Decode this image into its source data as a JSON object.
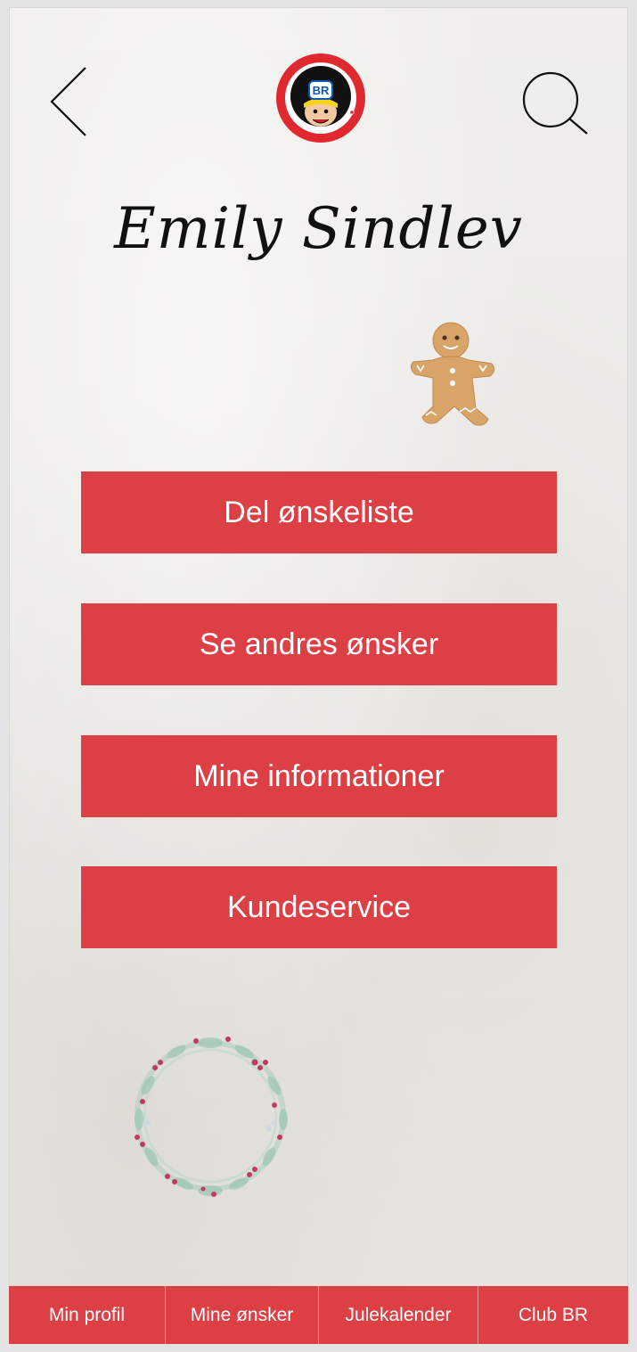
{
  "header": {
    "back_icon": "chevron-left-icon",
    "search_icon": "search-icon",
    "logo_text": "BR"
  },
  "profile": {
    "name": "Emily Sindlev"
  },
  "menu": {
    "items": [
      {
        "label": "Del ønskeliste"
      },
      {
        "label": "Se andres ønsker"
      },
      {
        "label": "Mine informationer"
      },
      {
        "label": "Kundeservice"
      }
    ]
  },
  "tabbar": {
    "tabs": [
      {
        "label": "Min profil"
      },
      {
        "label": "Mine ønsker"
      },
      {
        "label": "Julekalender"
      },
      {
        "label": "Club BR"
      }
    ]
  },
  "colors": {
    "accent": "#dd4044",
    "background": "#ecebe7",
    "text_dark": "#111111"
  }
}
